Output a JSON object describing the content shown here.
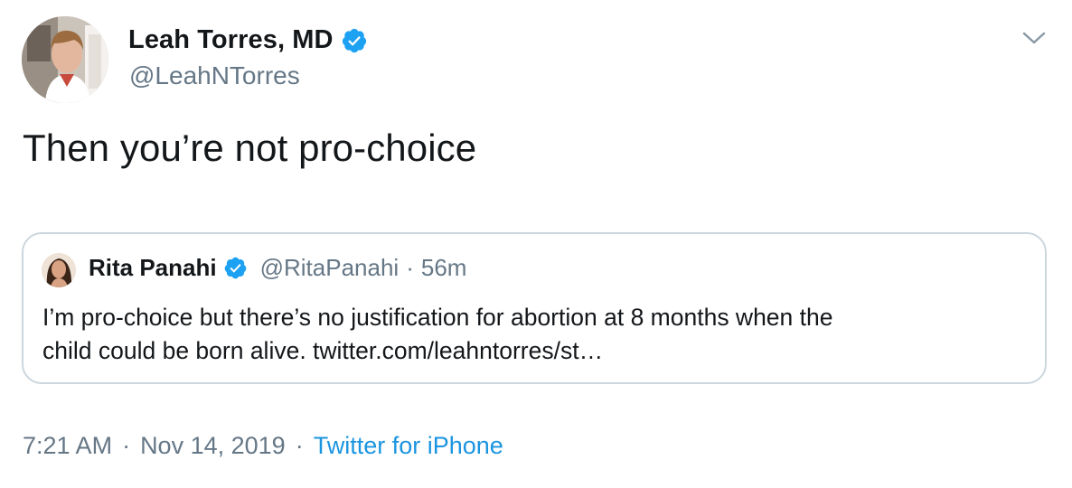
{
  "tweet": {
    "author": {
      "name": "Leah Torres, MD",
      "handle": "@LeahNTorres",
      "verified": true
    },
    "text": "Then you’re not pro-choice",
    "quoted": {
      "author_name": "Rita Panahi",
      "handle": "@RitaPanahi",
      "separator": "·",
      "time_ago": "56m",
      "text_line1": "I’m pro-choice but there’s no justification for abortion at 8 months  when the",
      "text_line2": "child could be born alive. twitter.com/leahntorres/st…"
    },
    "footer": {
      "time": "7:21 AM",
      "separator1": "·",
      "date": "Nov 14, 2019",
      "separator2": "·",
      "source": "Twitter for iPhone"
    }
  },
  "colors": {
    "text": "#14171a",
    "secondary": "#657786",
    "link": "#1b95e0",
    "verified": "#1da1f2",
    "border": "#ccd6dd"
  },
  "icons": {
    "caret": "chevron-down-icon",
    "verified": "verified-badge-icon"
  }
}
